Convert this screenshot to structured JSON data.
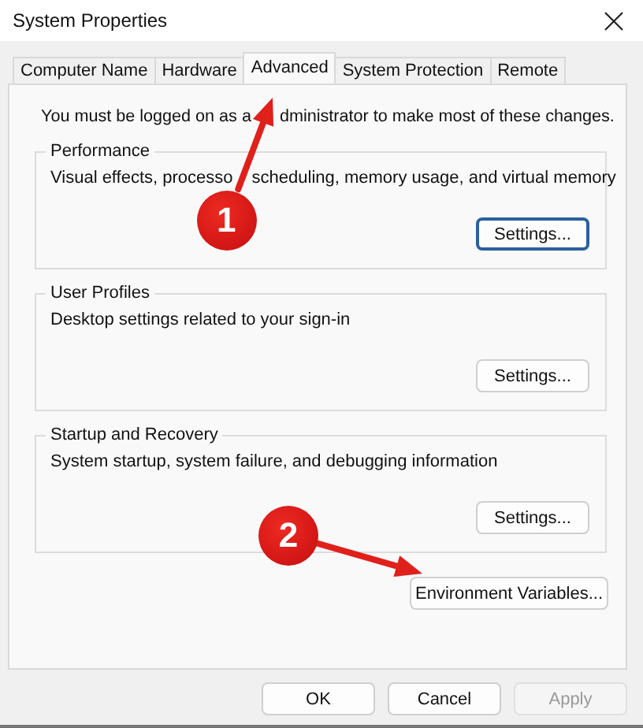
{
  "window": {
    "title": "System Properties"
  },
  "tabs": [
    {
      "label": "Computer Name",
      "selected": false
    },
    {
      "label": "Hardware",
      "selected": false
    },
    {
      "label": "Advanced",
      "selected": true
    },
    {
      "label": "System Protection",
      "selected": false
    },
    {
      "label": "Remote",
      "selected": false
    }
  ],
  "notice": [
    "You must be logged on as a",
    "dministrator to make most of these changes."
  ],
  "groups": [
    {
      "title": "Performance",
      "description": [
        "Visual effects, processo",
        "scheduling, memory usage, and virtual memory"
      ],
      "button": "Settings...",
      "focused": true
    },
    {
      "title": "User Profiles",
      "description": [
        "Desktop settings related to your sign-in"
      ],
      "button": "Settings...",
      "focused": false
    },
    {
      "title": "Startup and Recovery",
      "description": [
        "System startup, system failure, and debugging information"
      ],
      "button": "Settings...",
      "focused": false
    }
  ],
  "environment_button": "Environment Variables...",
  "footer_buttons": [
    {
      "label": "OK",
      "disabled": false
    },
    {
      "label": "Cancel",
      "disabled": false
    },
    {
      "label": "Apply",
      "disabled": true
    }
  ],
  "annotations": [
    {
      "number": "1"
    },
    {
      "number": "2"
    }
  ]
}
